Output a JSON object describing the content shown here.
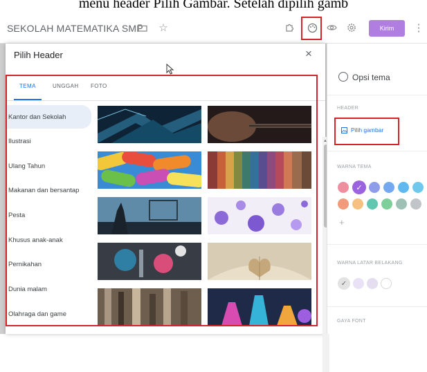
{
  "caption": "menu header Pilih Gambar. Setelah dipilih gamb",
  "topbar": {
    "doc_title": "SEKOLAH MATEMATIKA SMP",
    "send_label": "Kirim"
  },
  "dialog": {
    "title": "Pilih Header",
    "close": "×",
    "tabs": [
      "TEMA",
      "UNGGAH",
      "FOTO"
    ],
    "active_tab": "TEMA",
    "categories": [
      "Kantor dan Sekolah",
      "Ilustrasi",
      "Ulang Tahun",
      "Makanan dan bersantap",
      "Pesta",
      "Khusus anak-anak",
      "Pernikahan",
      "Dunia malam",
      "Olahraga dan game"
    ],
    "active_category": "Kantor dan Sekolah"
  },
  "theme_panel": {
    "title": "Opsi tema",
    "header_section": "HEADER",
    "choose_image": "Pilih gambar",
    "theme_color_section": "WARNA TEMA",
    "theme_colors": [
      "#ee8fa0",
      "#9b63e0",
      "#8f9cea",
      "#74a9f0",
      "#5fb8ef",
      "#70c9ec",
      "#f29a7c",
      "#f5c080",
      "#62c7b0",
      "#7fcf9a",
      "#9fc1b5",
      "#c1c5c9"
    ],
    "background_section": "WARNA LATAR BELAKANG",
    "background_colors": [
      "#e3e3e3",
      "#e9e1f6",
      "#e3ddef",
      "#ffffff"
    ],
    "font_section": "GAYA FONT"
  }
}
